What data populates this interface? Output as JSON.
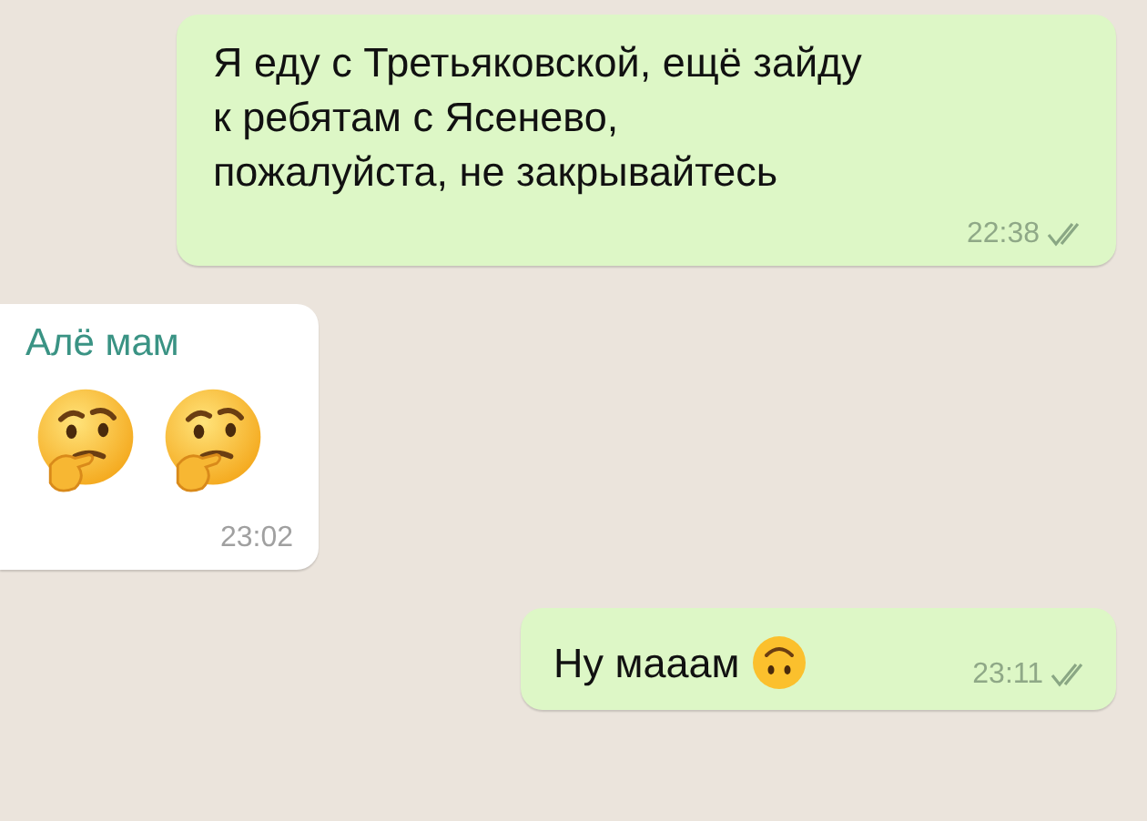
{
  "messages": [
    {
      "kind": "outgoing",
      "lines": [
        "Я еду с Третьяковской, ещё зайду",
        "к ребятам с Ясенево,",
        "пожалуйста, не закрывайтесь"
      ],
      "time": "22:38",
      "read": false
    },
    {
      "kind": "incoming",
      "sender": "Алё мам",
      "emojis": [
        {
          "kind": "thinking"
        },
        {
          "kind": "thinking"
        }
      ],
      "time": "23:02"
    },
    {
      "kind": "outgoing",
      "lines": [
        "Ну мааам"
      ],
      "emojis": [
        {
          "kind": "upside-down"
        }
      ],
      "time": "23:11",
      "read": false
    }
  ]
}
